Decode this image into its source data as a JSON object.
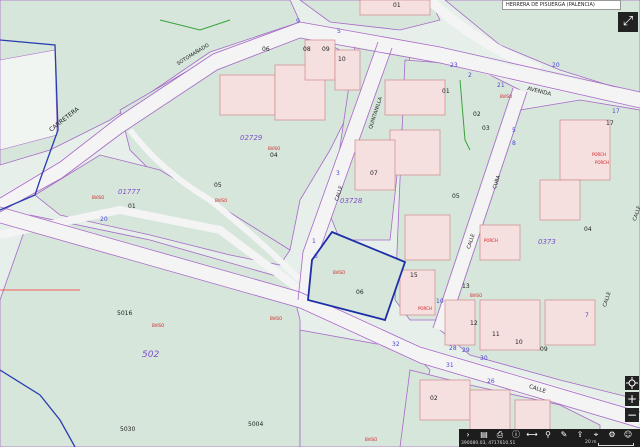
{
  "title": "HERRERA DE PISUERGA (PALENCIA)",
  "colors": {
    "parcel_fill": "#d6e6db",
    "land_fill": "#e6efe9",
    "road_fill": "#f4f4f5",
    "boundary": "#a868c8",
    "building_fill": "#f6dfdf",
    "building_stroke": "#d08a8a",
    "selected_parcel": "#1c2fa8",
    "district_line": "#2a3db0",
    "green_line": "#3aa23a",
    "red_line": "#ff2b2b",
    "label_red": "#d22222",
    "label_purple": "#7f50c8",
    "label_blue": "#5046d2"
  },
  "street_labels": {
    "carretera": "CARRETERA",
    "sotomanado": "SOTOMAÑADO",
    "quintanilla": "QUINTANILLA",
    "calle1": "CALLE",
    "cuba": "CUBA",
    "calle2": "CALLE",
    "avenida": "AVENIDA",
    "calle3": "CALLE",
    "calle4": "CALLE",
    "calle5": "CALLE"
  },
  "block_numbers": {
    "b02729": "02729",
    "b01777": "01777",
    "b03728": "03728",
    "b502": "502",
    "b0373": "0373"
  },
  "parcel_numbers": {
    "p01": "01",
    "p06": "06",
    "p08": "08",
    "p09": "09",
    "p10": "10",
    "p04": "04",
    "p05a": "05",
    "p01b": "01",
    "p07": "07",
    "p05b": "05",
    "p01c": "01",
    "p02": "02",
    "p03": "03",
    "p06sel": "06",
    "p15": "15",
    "p5016": "5016",
    "p5030": "5030",
    "p5004": "5004",
    "p13": "13",
    "p12": "12",
    "p11": "11",
    "p10b": "10",
    "p09b": "09",
    "p02b": "02",
    "p04b": "04",
    "p17": "17"
  },
  "edge_numbers": {
    "e20a": "20",
    "e20b": "20",
    "e9": "9",
    "e5a": "5",
    "e23": "23",
    "e2": "2",
    "e21": "21",
    "e3a": "3",
    "e5b": "5",
    "e1": "1",
    "e3b": "3",
    "e32": "32",
    "e31": "31",
    "e29": "29",
    "e30": "30",
    "e26": "26",
    "e28": "28",
    "e10": "10",
    "e8": "8",
    "e7": "7",
    "e17": "17"
  },
  "red_labels": {
    "r1": "BVISO",
    "r2": "BVISO",
    "r3": "BVISO",
    "r4": "BVISO",
    "r5": "BVISO",
    "r6": "BVISO",
    "r7": "BVISO",
    "r8": "PORCH",
    "r9": "PORCH",
    "r10": "PORCH",
    "r11": "PORCH",
    "r12": "BVISO",
    "r13": "BVISO"
  },
  "toolbar": {
    "coords": "390080.03, 4717610.51",
    "scale": "20 m",
    "zoom_in": "+",
    "zoom_out": "−",
    "fullscreen": "⤢"
  },
  "icons": {
    "fullscreen": "expand-icon",
    "zoom_in": "plus-icon",
    "zoom_out": "minus-icon"
  }
}
